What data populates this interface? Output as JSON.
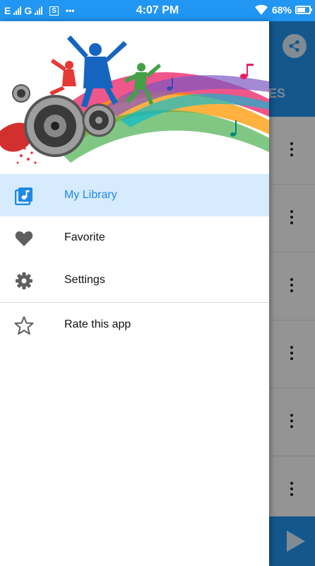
{
  "status_bar": {
    "carrier_1": "E",
    "carrier_2": "G",
    "sim_icon": "S",
    "more_dots": "•••",
    "time": "4:07 PM",
    "battery_percent": "68%",
    "battery_level": 0.68
  },
  "background_app": {
    "tab_label": "ES",
    "share_icon": "share-icon",
    "row_count": 6,
    "play_icon": "play-icon"
  },
  "drawer": {
    "header_image": "music-banner-illustration",
    "items": [
      {
        "label": "My Library",
        "icon": "library-music-icon",
        "selected": true
      },
      {
        "label": "Favorite",
        "icon": "heart-icon",
        "selected": false
      },
      {
        "label": "Settings",
        "icon": "gear-icon",
        "selected": false
      },
      {
        "label": "Rate this app",
        "icon": "star-outline-icon",
        "selected": false
      }
    ]
  },
  "colors": {
    "primary": "#2196f3",
    "selected_bg": "#d6ebfd",
    "selected_text": "#1e88e5",
    "icon_grey": "#5f5f5f"
  }
}
